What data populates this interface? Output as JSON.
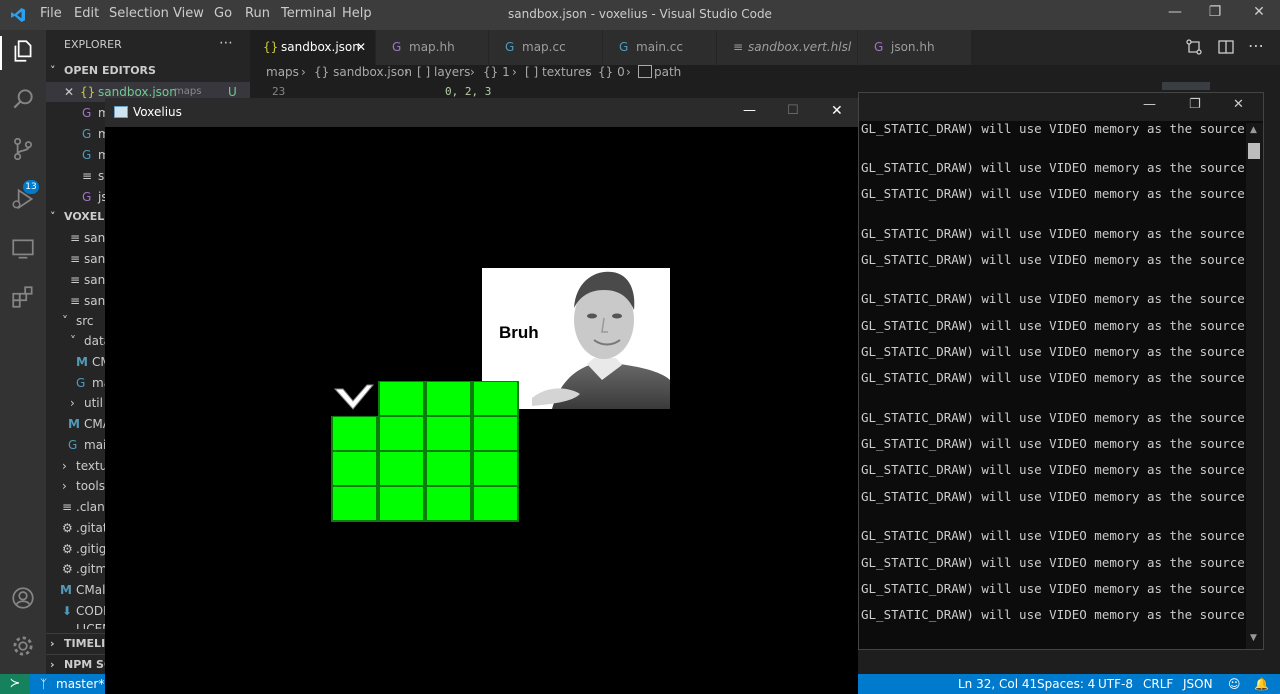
{
  "titlebar": {
    "menu": [
      "File",
      "Edit",
      "Selection",
      "View",
      "Go",
      "Run",
      "Terminal",
      "Help"
    ],
    "title": "sandbox.json - voxelius - Visual Studio Code"
  },
  "sidebar": {
    "header": "EXPLORER",
    "open_editors": "OPEN EDITORS",
    "open_file": "sandbox.json",
    "open_file_dir": "maps",
    "open_file_status": "U",
    "open_items": [
      "m",
      "m",
      "m",
      "s",
      "js"
    ],
    "project": "VOXELIU",
    "tree": [
      "sand",
      "sand",
      "sand",
      "sand",
      "src",
      "data",
      "CM",
      "ma",
      "util",
      "CMA",
      "mai",
      "textu",
      "tools",
      ".clang",
      ".gitat",
      ".gitig",
      ".gitm",
      "CMal",
      "CODI",
      "LICEN"
    ],
    "timeline": "TIMELIN",
    "npm": "NPM SC"
  },
  "activity": {
    "scm_badge": "13"
  },
  "tabs": [
    {
      "label": "sandbox.json",
      "icon": "{}",
      "active": true
    },
    {
      "label": "map.hh",
      "icon": "C"
    },
    {
      "label": "map.cc",
      "icon": "C"
    },
    {
      "label": "main.cc",
      "icon": "C"
    },
    {
      "label": "sandbox.vert.hlsl",
      "icon": "≡"
    },
    {
      "label": "json.hh",
      "icon": "C"
    }
  ],
  "breadcrumb": [
    "maps",
    "{} sandbox.json",
    "[ ] layers",
    "{} 1",
    "[ ] textures",
    "{} 0",
    "path"
  ],
  "editor": {
    "line_number": "23",
    "line_text": "0, 2, 3"
  },
  "voxelius": {
    "title": "Voxelius",
    "image_label": "Bruh",
    "grid_color": "#00ff00"
  },
  "console": {
    "line_text": "GL_STATIC_DRAW) will use VIDEO memory as the source"
  },
  "status": {
    "branch": "master*",
    "position": "Ln 32, Col 41",
    "spaces": "Spaces: 4",
    "encoding": "UTF-8",
    "eol": "CRLF",
    "language": "JSON"
  },
  "colors": {
    "accent": "#007acc",
    "titlebar": "#3c3c3c"
  }
}
